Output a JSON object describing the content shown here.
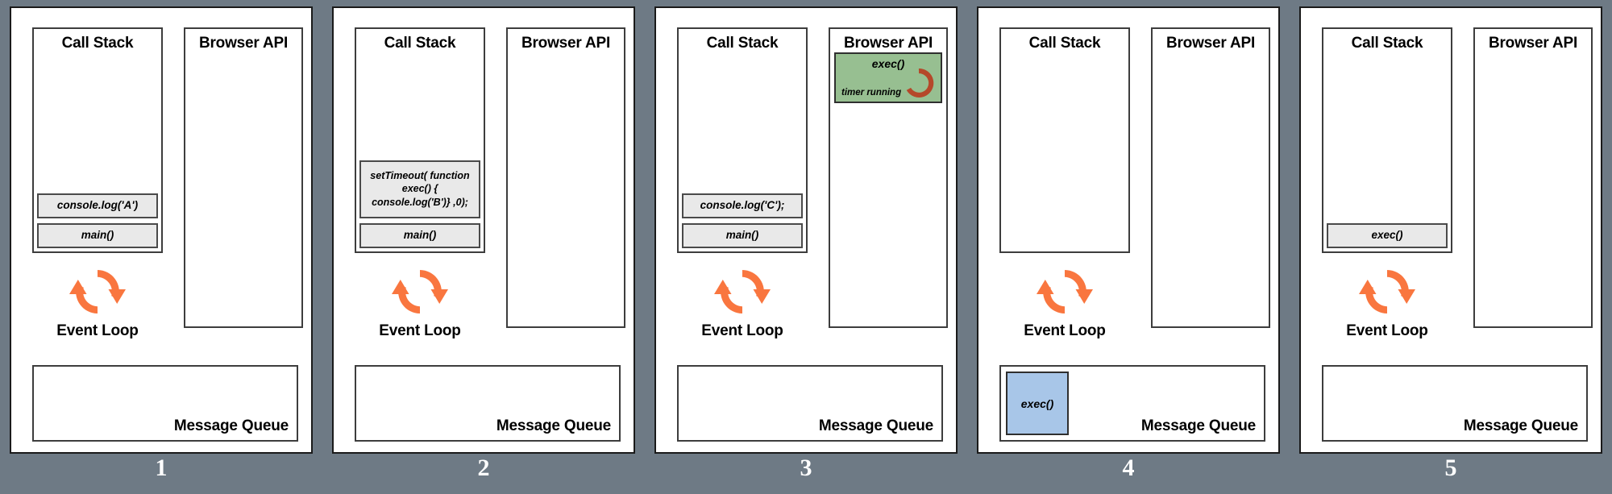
{
  "theme": {
    "background": "#6e7a85",
    "panel_background": "#ffffff",
    "frame_fill": "#e9e9e9",
    "timer_fill": "#97bf91",
    "queue_item_fill": "#a8c6e8",
    "event_loop_color": "#f9763f",
    "spinner_color": "#b5482a",
    "number_color": "#ffffff"
  },
  "labels": {
    "call_stack": "Call Stack",
    "browser_api": "Browser API",
    "message_queue": "Message Queue",
    "event_loop": "Event Loop"
  },
  "icons": {
    "event_loop": "event-loop-refresh-icon",
    "timer_spinner": "timer-spinner-icon"
  },
  "panels": [
    {
      "number": "1",
      "call_stack": {
        "title": "Call Stack",
        "frames": [
          {
            "text": "console.log('A')",
            "tall": false
          },
          {
            "text": "main()",
            "tall": false
          }
        ]
      },
      "browser_api": {
        "title": "Browser API",
        "timer": null
      },
      "message_queue": {
        "title": "Message Queue",
        "items": []
      },
      "event_loop": {
        "label": "Event Loop"
      }
    },
    {
      "number": "2",
      "call_stack": {
        "title": "Call Stack",
        "frames": [
          {
            "text": "setTimeout( function\nexec() {\nconsole.log('B')} ,0);",
            "tall": true
          },
          {
            "text": "main()",
            "tall": false
          }
        ]
      },
      "browser_api": {
        "title": "Browser API",
        "timer": null
      },
      "message_queue": {
        "title": "Message Queue",
        "items": []
      },
      "event_loop": {
        "label": "Event Loop"
      }
    },
    {
      "number": "3",
      "call_stack": {
        "title": "Call Stack",
        "frames": [
          {
            "text": "console.log('C');",
            "tall": false
          },
          {
            "text": "main()",
            "tall": false
          }
        ]
      },
      "browser_api": {
        "title": "Browser API",
        "timer": {
          "title": "exec()",
          "status": "timer running"
        }
      },
      "message_queue": {
        "title": "Message Queue",
        "items": []
      },
      "event_loop": {
        "label": "Event Loop"
      }
    },
    {
      "number": "4",
      "call_stack": {
        "title": "Call Stack",
        "frames": []
      },
      "browser_api": {
        "title": "Browser API",
        "timer": null
      },
      "message_queue": {
        "title": "Message Queue",
        "items": [
          {
            "text": "exec()"
          }
        ]
      },
      "event_loop": {
        "label": "Event Loop"
      }
    },
    {
      "number": "5",
      "call_stack": {
        "title": "Call Stack",
        "frames": [
          {
            "text": "exec()",
            "tall": false
          }
        ]
      },
      "browser_api": {
        "title": "Browser API",
        "timer": null
      },
      "message_queue": {
        "title": "Message Queue",
        "items": []
      },
      "event_loop": {
        "label": "Event Loop"
      }
    }
  ]
}
